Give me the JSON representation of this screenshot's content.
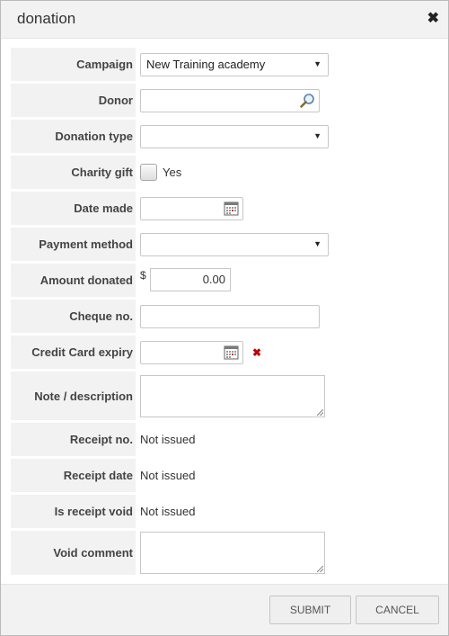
{
  "dialog": {
    "title": "donation",
    "close_glyph": "✖"
  },
  "form": {
    "campaign": {
      "label": "Campaign",
      "value": "New Training academy"
    },
    "donor": {
      "label": "Donor",
      "value": ""
    },
    "donation_type": {
      "label": "Donation type",
      "value": ""
    },
    "charity_gift": {
      "label": "Charity gift",
      "option": "Yes",
      "checked": false
    },
    "date_made": {
      "label": "Date made",
      "value": ""
    },
    "payment_method": {
      "label": "Payment method",
      "value": ""
    },
    "amount_donated": {
      "label": "Amount donated",
      "currency": "$",
      "value": "0.00"
    },
    "cheque_no": {
      "label": "Cheque no.",
      "value": ""
    },
    "credit_card_expiry": {
      "label": "Credit Card expiry",
      "value": "",
      "error_glyph": "✖"
    },
    "note": {
      "label": "Note / description",
      "value": ""
    },
    "receipt_no": {
      "label": "Receipt no.",
      "value": "Not issued"
    },
    "receipt_date": {
      "label": "Receipt date",
      "value": "Not issued"
    },
    "receipt_void": {
      "label": "Is receipt void",
      "value": "Not issued"
    },
    "void_comment": {
      "label": "Void comment",
      "value": ""
    }
  },
  "footer": {
    "submit_label": "SUBMIT",
    "cancel_label": "CANCEL"
  },
  "icons": {
    "dropdown": "chevron-down-icon",
    "search": "magnifier-icon",
    "calendar": "calendar-icon",
    "close": "close-icon"
  },
  "colors": {
    "label_bg": "#f2f2f2",
    "error": "#c00000",
    "button_bg": "#efefef"
  }
}
